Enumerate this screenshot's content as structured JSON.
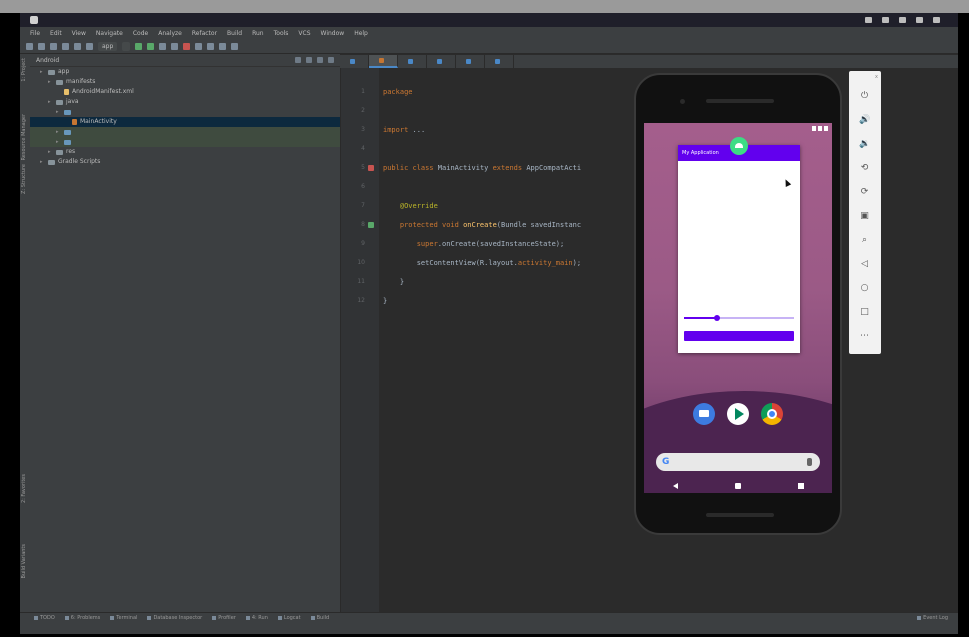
{
  "os": {
    "window_title": "",
    "tray_time": ""
  },
  "menubar": {
    "items": [
      "File",
      "Edit",
      "View",
      "Navigate",
      "Code",
      "Analyze",
      "Refactor",
      "Build",
      "Run",
      "Tools",
      "VCS",
      "Window",
      "Help"
    ],
    "title": ""
  },
  "toolbar": {
    "run_config": "app",
    "device": ""
  },
  "tabs": [
    {
      "label": "",
      "type": "xml",
      "active": false
    },
    {
      "label": "",
      "type": "kt",
      "active": true
    },
    {
      "label": "",
      "type": "xml",
      "active": false
    },
    {
      "label": "",
      "type": "xml",
      "active": false
    },
    {
      "label": "",
      "type": "xml",
      "active": false
    },
    {
      "label": "",
      "type": "xml",
      "active": false
    }
  ],
  "project": {
    "header": "Android",
    "tree": [
      {
        "label": "app",
        "indent": 0,
        "kind": "folder"
      },
      {
        "label": "manifests",
        "indent": 1,
        "kind": "folder"
      },
      {
        "label": "AndroidManifest.xml",
        "indent": 2,
        "kind": "xml"
      },
      {
        "label": "java",
        "indent": 1,
        "kind": "folder"
      },
      {
        "label": "",
        "indent": 2,
        "kind": "pkg"
      },
      {
        "label": "MainActivity",
        "indent": 3,
        "kind": "kt",
        "selected": true
      },
      {
        "label": "",
        "suffix": "",
        "indent": 2,
        "kind": "pkg",
        "highlight": true
      },
      {
        "label": "",
        "suffix": "",
        "indent": 2,
        "kind": "pkg",
        "highlight": true
      },
      {
        "label": "res",
        "indent": 1,
        "kind": "folder"
      },
      {
        "label": "Gradle Scripts",
        "indent": 0,
        "kind": "folder"
      }
    ]
  },
  "left_strip": [
    "1: Project",
    "Resource Manager",
    "Z: Structure",
    "2: Favorites",
    "Build Variants"
  ],
  "editor": {
    "lines": [
      [
        {
          "c": "kw",
          "t": "package "
        },
        {
          "c": "id",
          "t": ""
        }
      ],
      [
        {
          "c": "id",
          "t": ""
        }
      ],
      [
        {
          "c": "kw",
          "t": "import "
        },
        {
          "c": "id",
          "t": "..."
        }
      ],
      [
        {
          "c": "id",
          "t": ""
        }
      ],
      [
        {
          "c": "kw",
          "t": "public class "
        },
        {
          "c": "id",
          "t": "MainActivity "
        },
        {
          "c": "kw",
          "t": "extends "
        },
        {
          "c": "id",
          "t": "AppCompatActi"
        }
      ],
      [
        {
          "c": "id",
          "t": ""
        }
      ],
      [
        {
          "c": "an",
          "t": "    @Override"
        }
      ],
      [
        {
          "c": "kw",
          "t": "    protected void "
        },
        {
          "c": "fn",
          "t": "onCreate"
        },
        {
          "c": "id",
          "t": "(Bundle savedInstanc"
        }
      ],
      [
        {
          "c": "kw",
          "t": "        super"
        },
        {
          "c": "id",
          "t": ".onCreate(savedInstanceState);"
        }
      ],
      [
        {
          "c": "id",
          "t": "        setContentView(R.layout."
        },
        {
          "c": "kw",
          "t": "activity_main"
        },
        {
          "c": "id",
          "t": ");"
        }
      ],
      [
        {
          "c": "id",
          "t": "    }"
        }
      ],
      [
        {
          "c": "id",
          "t": "}"
        }
      ]
    ],
    "line_numbers": [
      "1",
      "2",
      "3",
      "4",
      "5",
      "6",
      "7",
      "8",
      "9",
      "10",
      "11",
      "12"
    ]
  },
  "emulator": {
    "app_title": "My Application",
    "label_text": "",
    "button_text": "",
    "slider_value": 0.3,
    "tools": [
      "power-icon",
      "volume-up-icon",
      "volume-down-icon",
      "rotate-left-icon",
      "rotate-right-icon",
      "camera-icon",
      "zoom-icon",
      "back-icon",
      "home-icon",
      "overview-icon",
      "more-icon"
    ],
    "tool_glyphs": [
      "⏻",
      "🔊",
      "🔉",
      "⟲",
      "⟳",
      "▣",
      "⌕",
      "◁",
      "○",
      "□",
      "⋯"
    ],
    "close": "x"
  },
  "bottom_tools": [
    "TODO",
    "6: Problems",
    "Terminal",
    "Database Inspector",
    "Profiler",
    "4: Run",
    "Logcat",
    "Build"
  ],
  "bottom_right": "Event Log",
  "status": {
    "message": "",
    "right": ""
  }
}
